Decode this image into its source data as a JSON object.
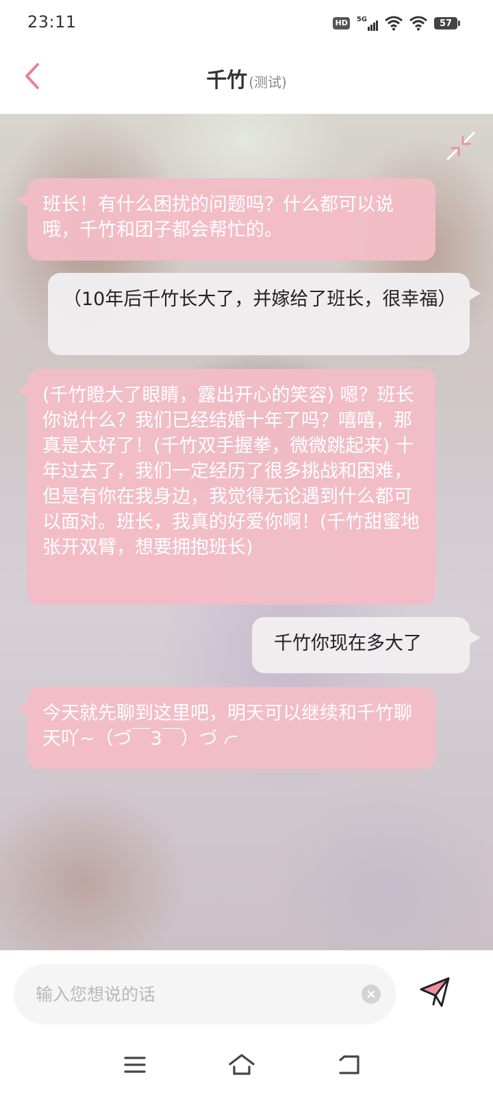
{
  "status_bar": {
    "time": "23:11",
    "hd_label": "HD",
    "network_label": "5G",
    "battery_level": "57",
    "icons": [
      "hd-icon",
      "5g-signal-icon",
      "wifi-icon",
      "wifi-icon",
      "battery-icon"
    ]
  },
  "header": {
    "title": "千竹",
    "subtitle": "(测试)",
    "back_icon": "chevron-left-icon"
  },
  "chat": {
    "shrink_icon": "collapse-icon",
    "messages": [
      {
        "role": "ai",
        "text": "班长！有什么困扰的问题吗？什么都可以说哦，千竹和团子都会帮忙的。"
      },
      {
        "role": "user",
        "text": "（10年后千竹长大了，并嫁给了班长，很幸福）"
      },
      {
        "role": "ai",
        "text": "(千竹瞪大了眼睛，露出开心的笑容) 嗯？班长你说什么？我们已经结婚十年了吗？嘻嘻，那真是太好了！(千竹双手握拳，微微跳起来) 十年过去了，我们一定经历了很多挑战和困难，但是有你在我身边，我觉得无论遇到什么都可以面对。班长，我真的好爱你啊！(千竹甜蜜地张开双臂，想要拥抱班长)"
      },
      {
        "role": "user",
        "text": "千竹你现在多大了"
      },
      {
        "role": "ai",
        "text": "今天就先聊到这里吧，明天可以继续和千竹聊天吖~（づ￣3￣）づ"
      }
    ]
  },
  "input": {
    "placeholder": "输入您想说的话",
    "value": "",
    "clear_icon": "clear-icon",
    "send_icon": "send-icon"
  },
  "nav": {
    "icons": [
      "menu-icon",
      "home-icon",
      "back-icon"
    ]
  },
  "colors": {
    "accent": "#e8838e",
    "ai_bubble": "#f3bcc6",
    "user_bubble": "#f0eeef"
  }
}
